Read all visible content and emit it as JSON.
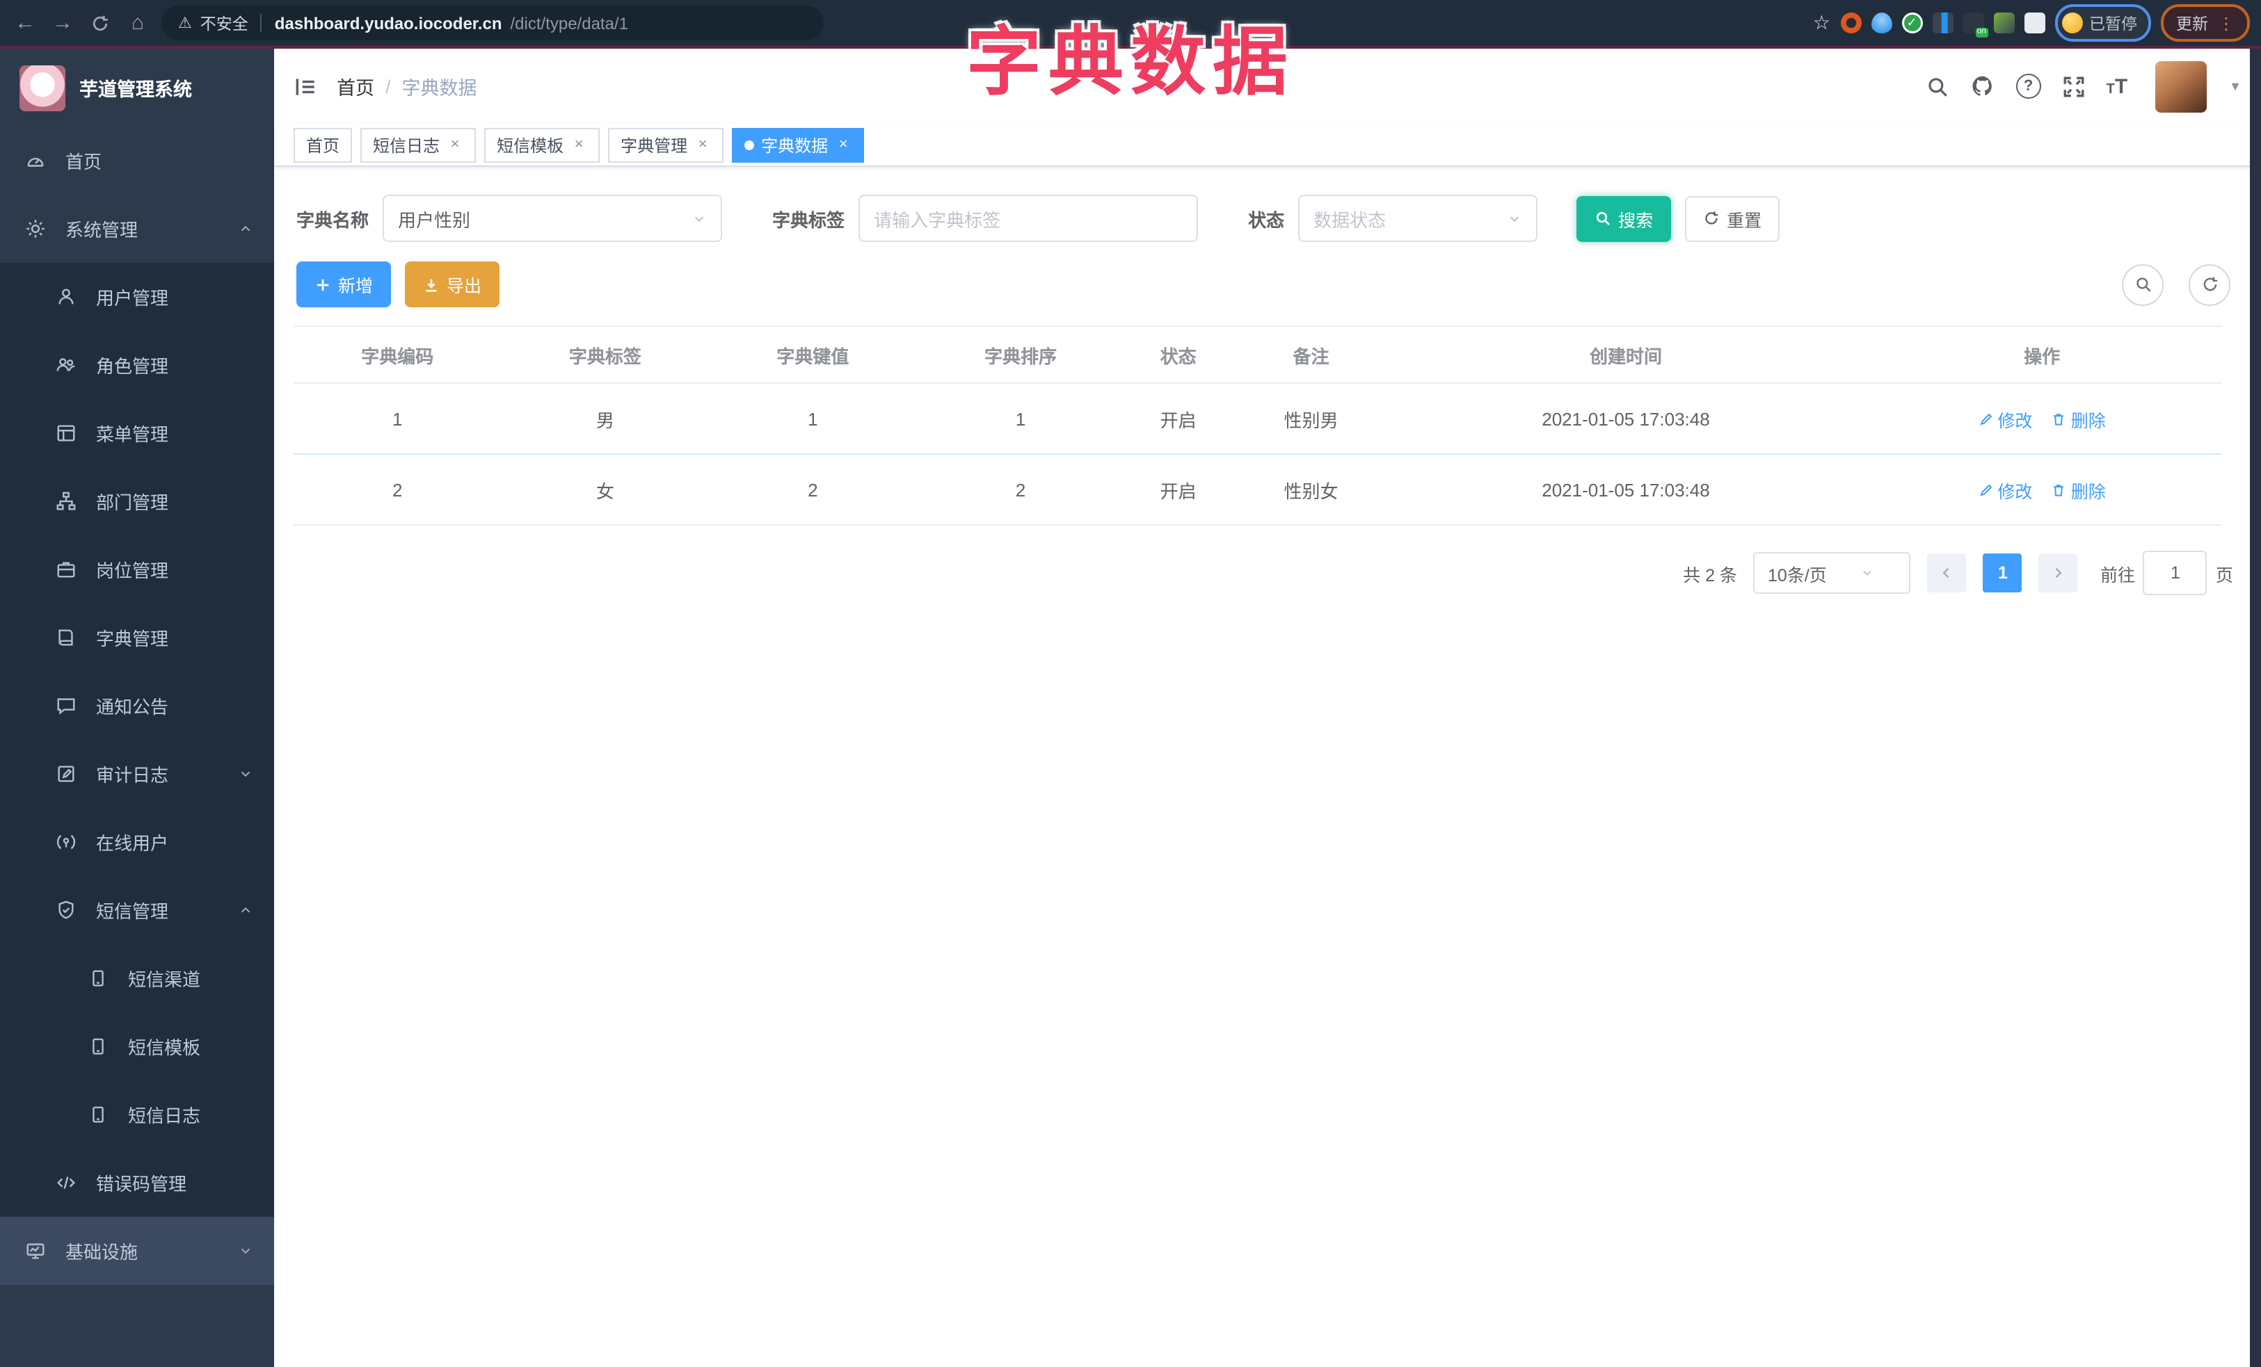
{
  "annotation": {
    "title": "字典数据",
    "color": "#ee3d5f"
  },
  "browser": {
    "security_label": "不安全",
    "url_host": "dashboard.yudao.iocoder.cn",
    "url_path": "/dict/type/data/1",
    "paused_label": "已暂停",
    "update_label": "更新"
  },
  "sidebar": {
    "logo_title": "芋道管理系统",
    "items": [
      {
        "label": "首页",
        "level": 1,
        "icon": "dashboard-icon"
      },
      {
        "label": "系统管理",
        "level": 1,
        "icon": "gear-icon",
        "caret": "up"
      },
      {
        "label": "用户管理",
        "level": 2,
        "icon": "user-icon"
      },
      {
        "label": "角色管理",
        "level": 2,
        "icon": "users-icon"
      },
      {
        "label": "菜单管理",
        "level": 2,
        "icon": "menu-list-icon"
      },
      {
        "label": "部门管理",
        "level": 2,
        "icon": "tree-icon"
      },
      {
        "label": "岗位管理",
        "level": 2,
        "icon": "briefcase-icon"
      },
      {
        "label": "字典管理",
        "level": 2,
        "icon": "book-icon"
      },
      {
        "label": "通知公告",
        "level": 2,
        "icon": "message-icon"
      },
      {
        "label": "审计日志",
        "level": 2,
        "icon": "edit-note-icon",
        "caret": "down"
      },
      {
        "label": "在线用户",
        "level": 2,
        "icon": "online-icon"
      },
      {
        "label": "短信管理",
        "level": 2,
        "icon": "shield-icon",
        "caret": "up"
      },
      {
        "label": "短信渠道",
        "level": 3,
        "icon": "phone-icon"
      },
      {
        "label": "短信模板",
        "level": 3,
        "icon": "phone-icon"
      },
      {
        "label": "短信日志",
        "level": 3,
        "icon": "phone-icon"
      },
      {
        "label": "错误码管理",
        "level": 2,
        "icon": "code-icon"
      },
      {
        "label": "基础设施",
        "level": 1,
        "icon": "monitor-icon",
        "caret": "down"
      }
    ]
  },
  "header": {
    "breadcrumb_home": "首页",
    "breadcrumb_separator": "/",
    "breadcrumb_current": "字典数据"
  },
  "tabs": {
    "items": [
      {
        "label": "首页",
        "closable": false,
        "active": false
      },
      {
        "label": "短信日志",
        "closable": true,
        "active": false
      },
      {
        "label": "短信模板",
        "closable": true,
        "active": false
      },
      {
        "label": "字典管理",
        "closable": true,
        "active": false
      },
      {
        "label": "字典数据",
        "closable": true,
        "active": true
      }
    ]
  },
  "filters": {
    "name_label": "字典名称",
    "name_value": "用户性别",
    "tag_label": "字典标签",
    "tag_placeholder": "请输入字典标签",
    "status_label": "状态",
    "status_placeholder": "数据状态",
    "search_label": "搜索",
    "reset_label": "重置"
  },
  "toolbar": {
    "add_label": "新增",
    "export_label": "导出"
  },
  "table": {
    "headers": [
      "字典编码",
      "字典标签",
      "字典键值",
      "字典排序",
      "状态",
      "备注",
      "创建时间",
      "操作"
    ],
    "rows": [
      [
        "1",
        "男",
        "1",
        "1",
        "开启",
        "性别男",
        "2021-01-05 17:03:48"
      ],
      [
        "2",
        "女",
        "2",
        "2",
        "开启",
        "性别女",
        "2021-01-05 17:03:48"
      ]
    ],
    "edit_label": "修改",
    "delete_label": "删除"
  },
  "pagination": {
    "total": "共 2 条",
    "page_size": "10条/页",
    "current_page": "1",
    "goto_prefix": "前往",
    "goto_value": "1",
    "goto_suffix": "页"
  },
  "colors": {
    "primary": "#409eff",
    "search_teal": "#18bc9c",
    "export_orange": "#e6a23c",
    "annotation_pink": "#ee3d5f",
    "sidebar_bg": "#2d3a4b",
    "submenu_bg": "#1f2d3d"
  }
}
